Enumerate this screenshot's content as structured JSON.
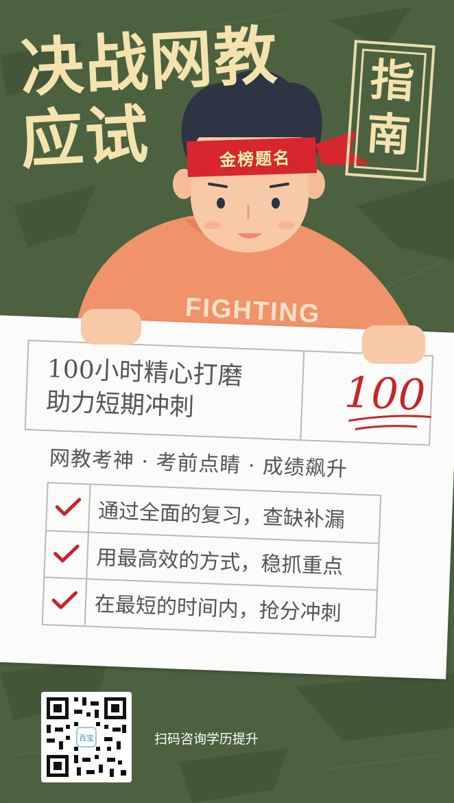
{
  "title": {
    "line1": "决战网教",
    "line2": "应试",
    "guide": "指南"
  },
  "headband": "金榜题名",
  "shirt_text": "FIGHTING",
  "card": {
    "line1": "100小时精心打磨",
    "line2": "助力短期冲刺",
    "score": "100",
    "slogan": "网教考神 · 考前点睛 · 成绩飙升",
    "items": [
      "通过全面的复习，查缺补漏",
      "用最高效的方式，稳抓重点",
      "在最短的时间内，抢分冲刺"
    ]
  },
  "qr": {
    "center_label": "百宝"
  },
  "scan_text": "扫码咨询学历提升",
  "colors": {
    "background": "#4c613f",
    "title": "#f4e3ae",
    "shirt": "#f0936a",
    "headband": "#d8262f",
    "check": "#c9232a"
  }
}
